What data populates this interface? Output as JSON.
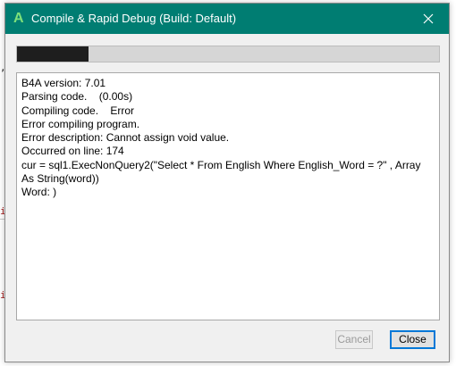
{
  "window": {
    "title": "Compile & Rapid Debug (Build: Default)",
    "app_icon_letter": "A",
    "accent": "#007d72"
  },
  "progress": {
    "fraction": 0.17,
    "fill_color": "#1e1e1e"
  },
  "log": {
    "lines": [
      "B4A version: 7.01",
      "Parsing code.    (0.00s)",
      "Compiling code.    Error",
      "Error compiling program.",
      "Error description: Cannot assign void value.",
      "Occurred on line: 174",
      "cur = sql1.ExecNonQuery2(\"Select * From English Where English_Word = ?\" , Array As String(word))",
      "Word: )"
    ]
  },
  "buttons": {
    "cancel_label": "Cancel",
    "close_label": "Close"
  },
  "background": {
    "marks": [
      ",",
      "i",
      "i"
    ]
  }
}
